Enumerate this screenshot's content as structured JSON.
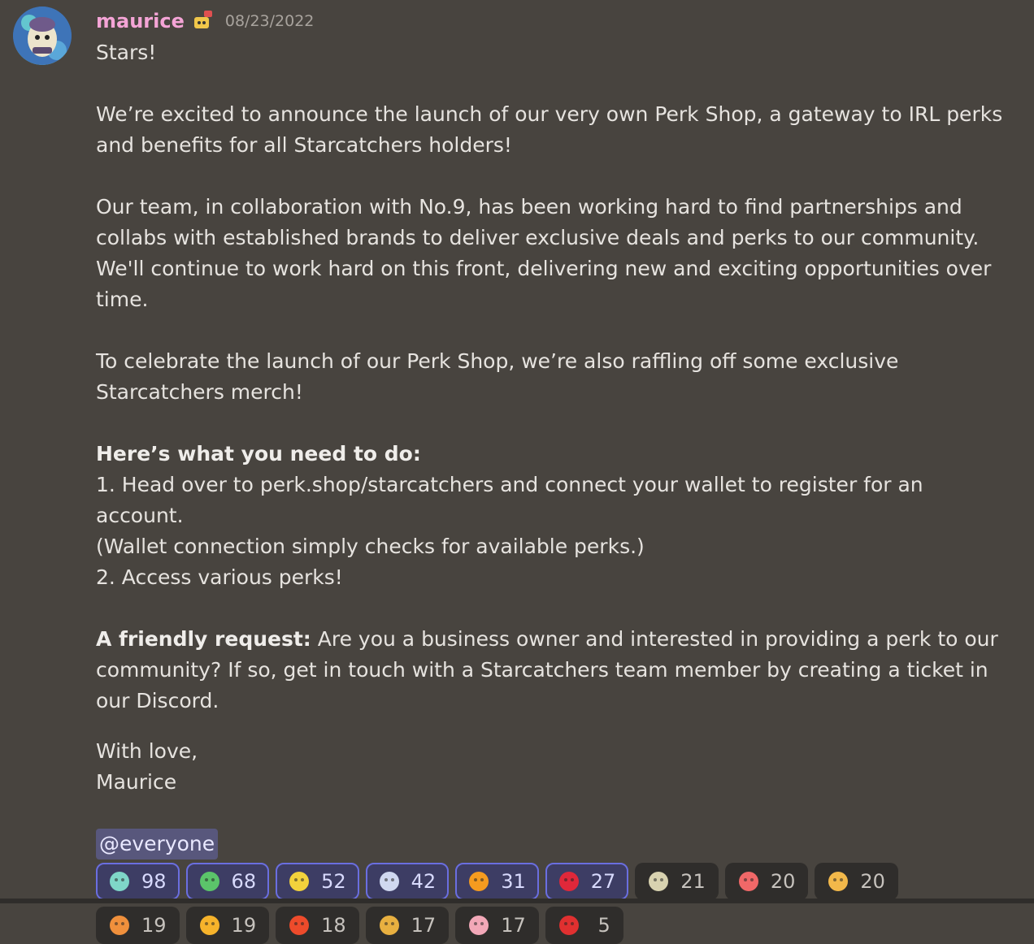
{
  "author": {
    "username": "maurice",
    "timestamp": "08/23/2022"
  },
  "message": {
    "greeting": "Stars!",
    "p1": "We’re excited to announce the launch of our very own Perk Shop, a gateway to IRL perks and benefits for all Starcatchers holders!",
    "p2": "Our team, in collaboration with No.9, has been working hard to find partnerships and collabs with established brands to deliver exclusive deals and perks to our community. We'll continue to work hard on this front, delivering new and exciting opportunities over time.",
    "p3": "To celebrate the launch of our Perk Shop, we’re also raffling off some exclusive Starcatchers merch!",
    "todo_heading": "Here’s what you need to do:",
    "step1a": "1. Head over to perk.shop/starcatchers and connect your wallet to register for an account.",
    "step1b": "(Wallet connection simply checks for available perks.)",
    "step2": "2. Access various perks!",
    "request_label": "A friendly request:",
    "request_text": " Are you a business owner and interested in providing a perk to our community? If so, get in touch with a Starcatchers team member by creating a ticket in our Discord.",
    "signoff1": "With love,",
    "signoff2": "Maurice",
    "mention": "@everyone"
  },
  "reactions": [
    {
      "emoji": "wgmi-emoji",
      "count": "98",
      "me": true,
      "color": "#7fd6c8"
    },
    {
      "emoji": "character-emoji",
      "count": "68",
      "me": true,
      "color": "#5bc46a"
    },
    {
      "emoji": "flower-emoji",
      "count": "52",
      "me": true,
      "color": "#f2d23c"
    },
    {
      "emoji": "rocket-emoji",
      "count": "42",
      "me": true,
      "color": "#d0d8f0"
    },
    {
      "emoji": "fire-emoji",
      "count": "31",
      "me": true,
      "color": "#f59b1f"
    },
    {
      "emoji": "heart-emoji",
      "count": "27",
      "me": true,
      "color": "#e0283a"
    },
    {
      "emoji": "tree-emoji",
      "count": "21",
      "me": false,
      "color": "#d8d2b0"
    },
    {
      "emoji": "sunglasses-emoji",
      "count": "20",
      "me": false,
      "color": "#f06868"
    },
    {
      "emoji": "landscape-emoji",
      "count": "20",
      "me": false,
      "color": "#f2b84a"
    },
    {
      "emoji": "star-face-emoji",
      "count": "19",
      "me": false,
      "color": "#f0903c"
    },
    {
      "emoji": "star-emoji",
      "count": "19",
      "me": false,
      "color": "#f6b32b"
    },
    {
      "emoji": "fire-heart-emoji",
      "count": "18",
      "me": false,
      "color": "#ee4b2b"
    },
    {
      "emoji": "character-2-emoji",
      "count": "17",
      "me": false,
      "color": "#e8b040"
    },
    {
      "emoji": "sparkle-emoji",
      "count": "17",
      "me": false,
      "color": "#f2a8b8"
    },
    {
      "emoji": "canada-flag-emoji",
      "count": "5",
      "me": false,
      "color": "#e03030"
    }
  ]
}
